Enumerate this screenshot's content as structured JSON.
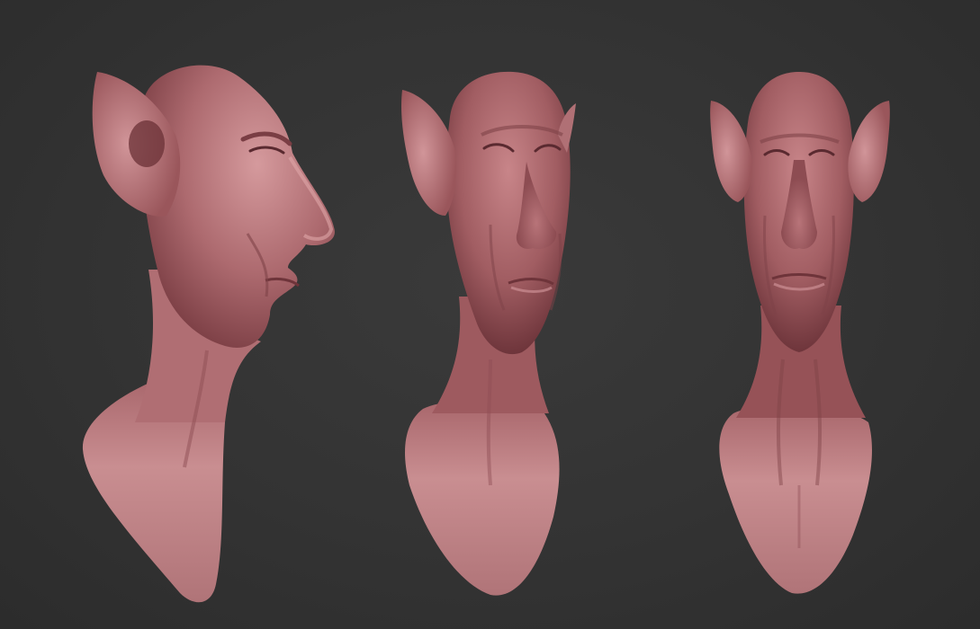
{
  "viewport": {
    "background_color": "#333333"
  },
  "render": {
    "material_base_color": "#b06e74",
    "material_highlight_color": "#e2a8ac",
    "material_shadow_color": "#5a2a30"
  },
  "busts": [
    {
      "view": "side-profile"
    },
    {
      "view": "three-quarter"
    },
    {
      "view": "front"
    }
  ]
}
